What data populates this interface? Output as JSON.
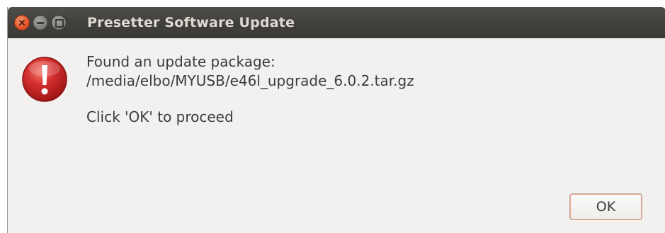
{
  "window": {
    "title": "Presetter Software Update"
  },
  "dialog": {
    "icon": "error-alert-icon",
    "message_line1": "Found an update package:",
    "message_line2": "/media/elbo/MYUSB/e46l_upgrade_6.0.2.tar.gz",
    "message_line3": "Click 'OK' to proceed",
    "ok_label": "OK"
  },
  "colors": {
    "titlebar": "#403f3c",
    "close_button": "#e5582c",
    "alert_red": "#d32e2e",
    "dialog_background": "#f2f1f0"
  }
}
